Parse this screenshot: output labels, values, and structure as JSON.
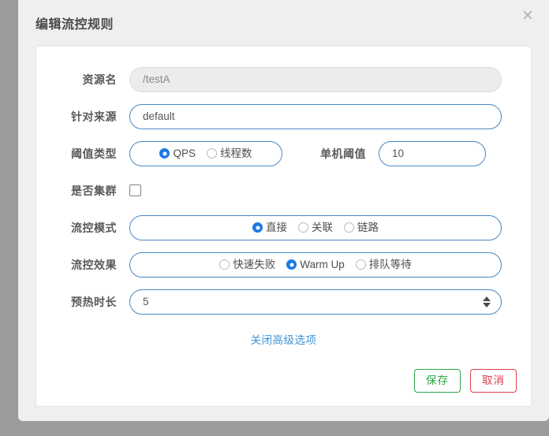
{
  "dialog": {
    "title": "编辑流控规则",
    "close_icon": "close-icon"
  },
  "form": {
    "resource": {
      "label": "资源名",
      "value": "/testA",
      "disabled": true
    },
    "origin": {
      "label": "针对来源",
      "value": "default"
    },
    "threshold_type": {
      "label": "阈值类型",
      "options": [
        {
          "label": "QPS",
          "selected": true
        },
        {
          "label": "线程数",
          "selected": false
        }
      ]
    },
    "single_threshold": {
      "label": "单机阈值",
      "value": "10"
    },
    "cluster": {
      "label": "是否集群",
      "checked": false
    },
    "flow_mode": {
      "label": "流控模式",
      "options": [
        {
          "label": "直接",
          "selected": true
        },
        {
          "label": "关联",
          "selected": false
        },
        {
          "label": "链路",
          "selected": false
        }
      ]
    },
    "flow_effect": {
      "label": "流控效果",
      "options": [
        {
          "label": "快速失败",
          "selected": false
        },
        {
          "label": "Warm Up",
          "selected": true
        },
        {
          "label": "排队等待",
          "selected": false
        }
      ]
    },
    "warmup_duration": {
      "label": "预热时长",
      "value": "5",
      "stepper_up_icon": "chevron-up-icon",
      "stepper_down_icon": "chevron-down-icon"
    },
    "advanced_toggle": {
      "label": "关闭高级选项"
    }
  },
  "footer": {
    "save_label": "保存",
    "cancel_label": "取消"
  },
  "colors": {
    "accent": "#1b7ae5",
    "border_blue": "#4a87c4",
    "link": "#3c93d8",
    "save": "#29a745",
    "cancel": "#e03b4b",
    "backdrop": "#9b9b9b"
  }
}
